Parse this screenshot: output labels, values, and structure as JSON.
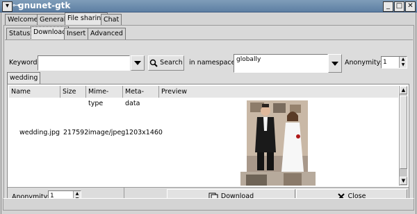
{
  "window": {
    "title": "gnunet-gtk",
    "menu_glyph": "▾",
    "pin_glyph": "⊶",
    "min_glyph": "_",
    "max_glyph": "□",
    "close_glyph": "✕"
  },
  "main_tabs": [
    "Welcome",
    "General",
    "File sharing",
    "Chat"
  ],
  "fs_tabs": [
    "Status",
    "Download",
    "Insert",
    "Advanced"
  ],
  "search": {
    "keyword_label": "Keyword:",
    "keyword_value": "",
    "search_label": "Search",
    "namespace_label": "in namespace",
    "namespace_value": "globally",
    "anonymity_label": "Anonymity:",
    "anonymity_value": "1"
  },
  "result_tab": "wedding",
  "table": {
    "columns": [
      "Name",
      "Size",
      "Mime-type",
      "Meta-data",
      "Preview"
    ],
    "rows": [
      {
        "name": "wedding.jpg",
        "size": "217592",
        "mime": "image/jpeg",
        "meta": "1203x1460"
      }
    ]
  },
  "bottom": {
    "anonymity_label": "Anonymity:",
    "anonymity_value": "1",
    "download_label": "Download",
    "close_label": "Close"
  }
}
